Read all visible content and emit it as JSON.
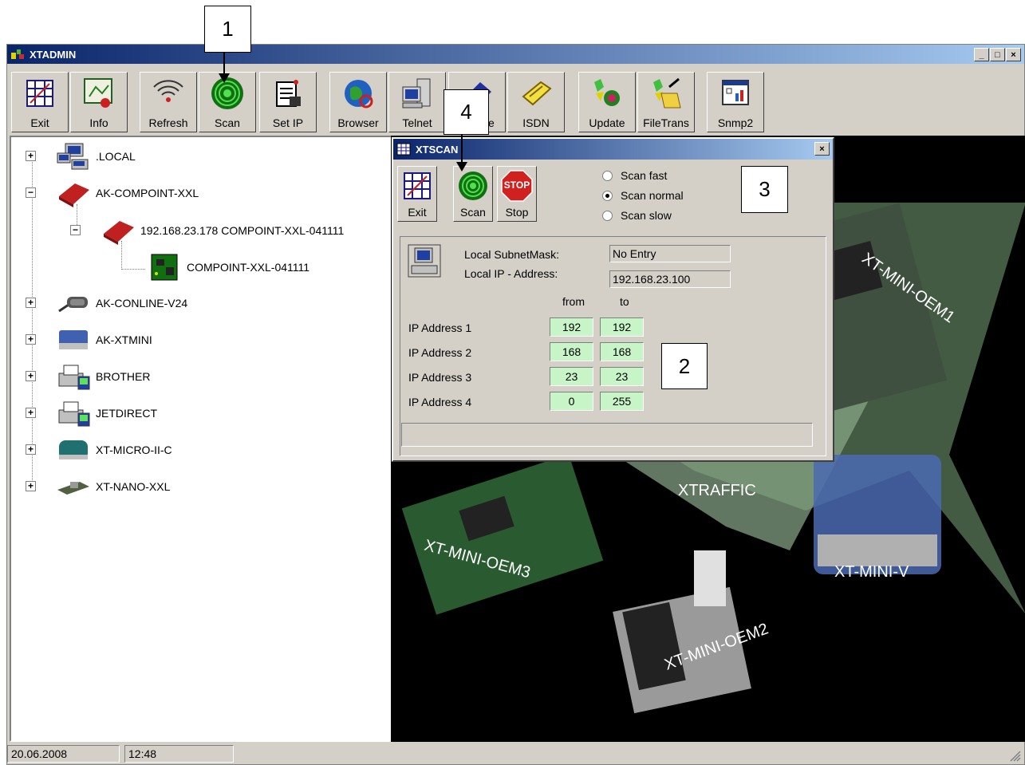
{
  "callouts": {
    "c1": "1",
    "c2": "2",
    "c3": "3",
    "c4": "4"
  },
  "window": {
    "title": "XTADMIN",
    "minimize": "_",
    "maximize": "□",
    "close": "×"
  },
  "toolbar": {
    "exit": "Exit",
    "info": "Info",
    "refresh": "Refresh",
    "scan": "Scan",
    "setip": "Set IP",
    "browser": "Browser",
    "telnet": "Telnet",
    "mode": "de",
    "isdn": "ISDN",
    "update": "Update",
    "filetrans": "FileTrans",
    "snmp2": "Snmp2"
  },
  "tree": {
    "items": [
      {
        "label": ".LOCAL",
        "icon": "network-computer-icon"
      },
      {
        "label": "AK-COMPOINT-XXL",
        "icon": "red-device-icon"
      },
      {
        "label": "192.168.23.178  COMPOINT-XXL-041111",
        "icon": "red-device-icon"
      },
      {
        "label": "COMPOINT-XXL-041111",
        "icon": "chip-icon"
      },
      {
        "label": "AK-CONLINE-V24",
        "icon": "cable-icon"
      },
      {
        "label": "AK-XTMINI",
        "icon": "modem-icon"
      },
      {
        "label": "BROTHER",
        "icon": "printer-icon"
      },
      {
        "label": "JETDIRECT",
        "icon": "printer-icon"
      },
      {
        "label": "XT-MICRO-II-C",
        "icon": "connector-icon"
      },
      {
        "label": "XT-NANO-XXL",
        "icon": "board-icon"
      }
    ]
  },
  "picture": {
    "labels": {
      "oem1": "XT-MINI-OEM1",
      "oem3": "XT-MINI-OEM3",
      "xtraffic": "XTRAFFIC",
      "miniv": "XT-MINI-V",
      "oem2": "XT-MINI-OEM2"
    }
  },
  "xtscan": {
    "title": "XTSCAN",
    "close": "×",
    "exit": "Exit",
    "scan": "Scan",
    "stop": "Stop",
    "stop_sign": "STOP",
    "speed": {
      "fast": "Scan fast",
      "normal": "Scan normal",
      "slow": "Scan slow",
      "selected": "normal"
    },
    "subnet_label": "Local SubnetMask:",
    "subnet_value": "No Entry",
    "localip_label": "Local IP - Address:",
    "localip_value": "192.168.23.100",
    "from_header": "from",
    "to_header": "to",
    "ranges": [
      {
        "label": "IP Address 1",
        "from": "192",
        "to": "192"
      },
      {
        "label": "IP Address 2",
        "from": "168",
        "to": "168"
      },
      {
        "label": "IP Address 3",
        "from": "23",
        "to": "23"
      },
      {
        "label": "IP Address 4",
        "from": "0",
        "to": "255"
      }
    ]
  },
  "status": {
    "date": "20.06.2008",
    "time": "12:48"
  },
  "colors": {
    "title_start": "#0a246a",
    "title_end": "#a6caf0",
    "face": "#d4d0c8",
    "ip_field": "#c8f5c8"
  }
}
